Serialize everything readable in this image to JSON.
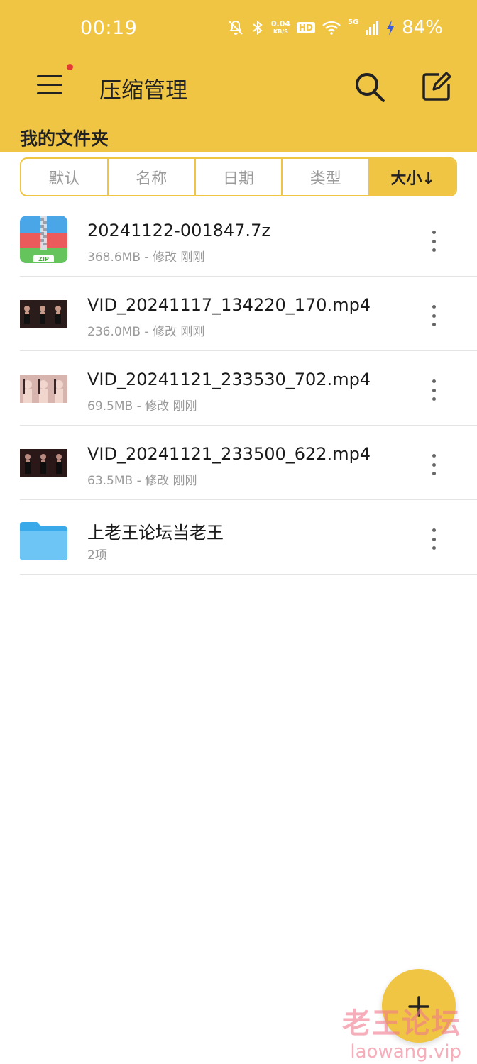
{
  "status_bar": {
    "time": "00:19",
    "net_speed_value": "0.04",
    "net_speed_unit": "KB/S",
    "hd": "HD",
    "signal": "5G",
    "battery": "84%"
  },
  "app_bar": {
    "title": "压缩管理",
    "menu_icon": "menu-icon",
    "search_icon": "search-icon",
    "edit_icon": "edit-icon"
  },
  "folder": {
    "title": "我的文件夹"
  },
  "sort_tabs": [
    {
      "label": "默认"
    },
    {
      "label": "名称"
    },
    {
      "label": "日期"
    },
    {
      "label": "类型"
    },
    {
      "label": "大小↓",
      "active": true
    }
  ],
  "files": [
    {
      "name": "20241122-001847.7z",
      "meta": "368.6MB - 修改 刚刚",
      "type": "zip",
      "icon_label": "ZIP"
    },
    {
      "name": "VID_20241117_134220_170.mp4",
      "meta": "236.0MB - 修改 刚刚",
      "type": "video"
    },
    {
      "name": "VID_20241121_233530_702.mp4",
      "meta": "69.5MB - 修改 刚刚",
      "type": "video"
    },
    {
      "name": "VID_20241121_233500_622.mp4",
      "meta": "63.5MB - 修改 刚刚",
      "type": "video"
    },
    {
      "name": "上老王论坛当老王",
      "meta": "2项",
      "type": "folder"
    }
  ],
  "fab": {
    "icon": "plus-icon"
  },
  "watermark": {
    "line1": "老王论坛",
    "line2": "laowang.vip"
  },
  "colors": {
    "accent": "#f1c544",
    "text": "#1a1a1a",
    "muted": "#9a9a9a",
    "divider": "#e3e3e3"
  }
}
